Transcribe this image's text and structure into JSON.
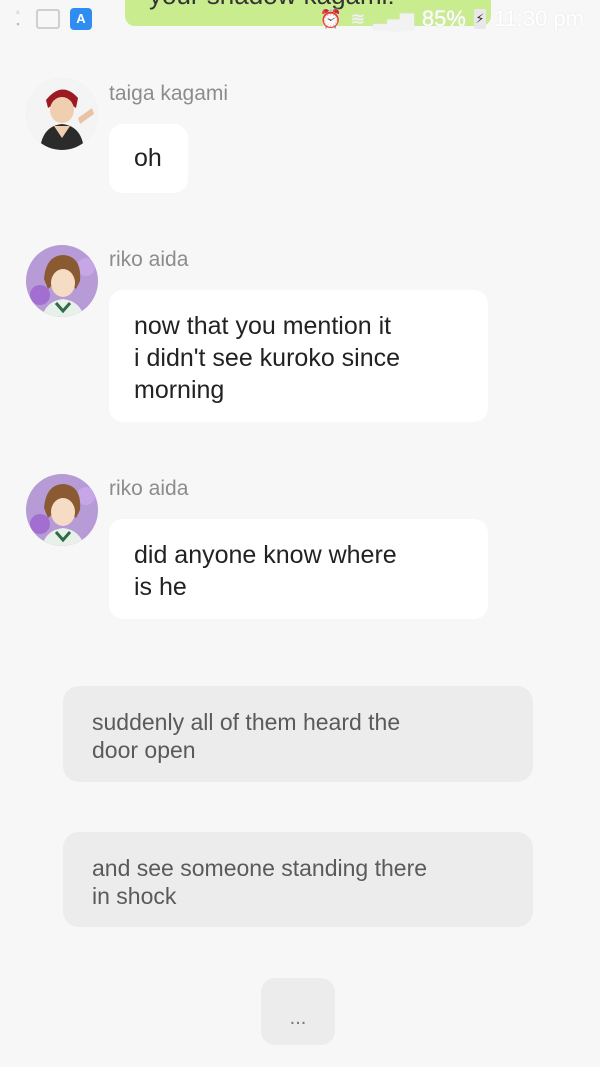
{
  "status_bar": {
    "top_message_fragment": "your shadow kagami!",
    "left_icons": [
      "notification-icon",
      "gallery-icon",
      "app-icon"
    ],
    "battery": "85%",
    "time": "11:30 pm"
  },
  "messages": [
    {
      "sender": "taiga kagami",
      "lines": [
        "oh"
      ]
    },
    {
      "sender": "riko aida",
      "lines": [
        "now that you mention it",
        "i didn't see kuroko since",
        "morning"
      ]
    },
    {
      "sender": "riko aida",
      "lines": [
        "did anyone know where",
        "is he"
      ]
    }
  ],
  "narrations": [
    {
      "lines": [
        "suddenly all of them heard the",
        "door open"
      ]
    },
    {
      "lines": [
        "and see someone standing there",
        "in shock"
      ]
    }
  ],
  "typing_indicator": "..."
}
